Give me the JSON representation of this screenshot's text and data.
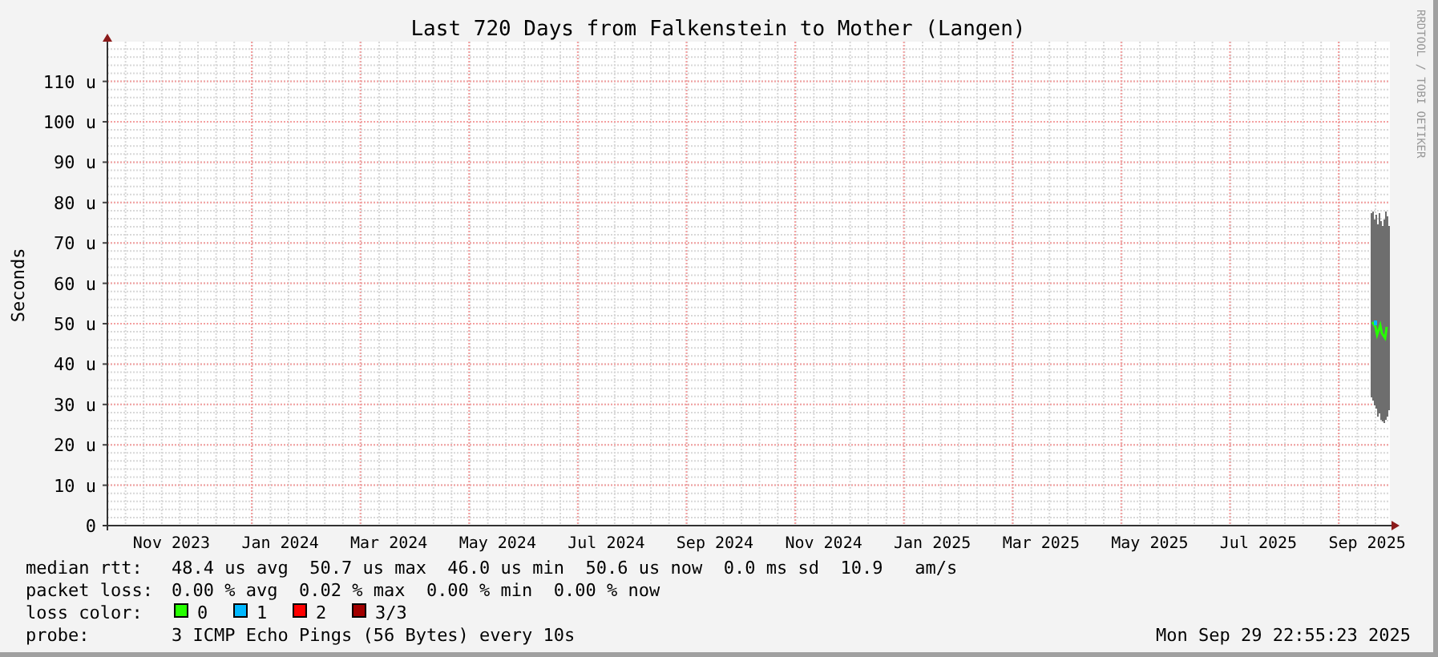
{
  "graph": {
    "title": "Last 720 Days from Falkenstein to Mother (Langen)",
    "ylabel": "Seconds",
    "credit": "RRDTOOL / TOBI OETIKER",
    "yticks": [
      "110 u",
      "100 u",
      "90 u",
      "80 u",
      "70 u",
      "60 u",
      "50 u",
      "40 u",
      "30 u",
      "20 u",
      "10 u",
      "0"
    ],
    "xticks": [
      "Nov 2023",
      "Jan 2024",
      "Mar 2024",
      "May 2024",
      "Jul 2024",
      "Sep 2024",
      "Nov 2024",
      "Jan 2025",
      "Mar 2025",
      "May 2025",
      "Jul 2025",
      "Sep 2025"
    ]
  },
  "legend": {
    "median_rtt": {
      "label": "median rtt:",
      "values": "48.4 us avg  50.7 us max  46.0 us min  50.6 us now  0.0 ms sd  10.9   am/s"
    },
    "packet_loss": {
      "label": "packet loss:",
      "values": "0.00 % avg  0.02 % max  0.00 % min  0.00 % now"
    },
    "loss_color": {
      "label": "loss color:",
      "items": [
        {
          "label": "0",
          "color": "#26ff00"
        },
        {
          "label": "1",
          "color": "#00b8ff"
        },
        {
          "label": "2",
          "color": "#ff0000"
        },
        {
          "label": "3/3",
          "color": "#a10000"
        }
      ]
    },
    "probe": {
      "label": "probe:",
      "values": "3 ICMP Echo Pings (56 Bytes) every 10s"
    },
    "timestamp": "Mon Sep 29 22:55:23 2025"
  }
}
